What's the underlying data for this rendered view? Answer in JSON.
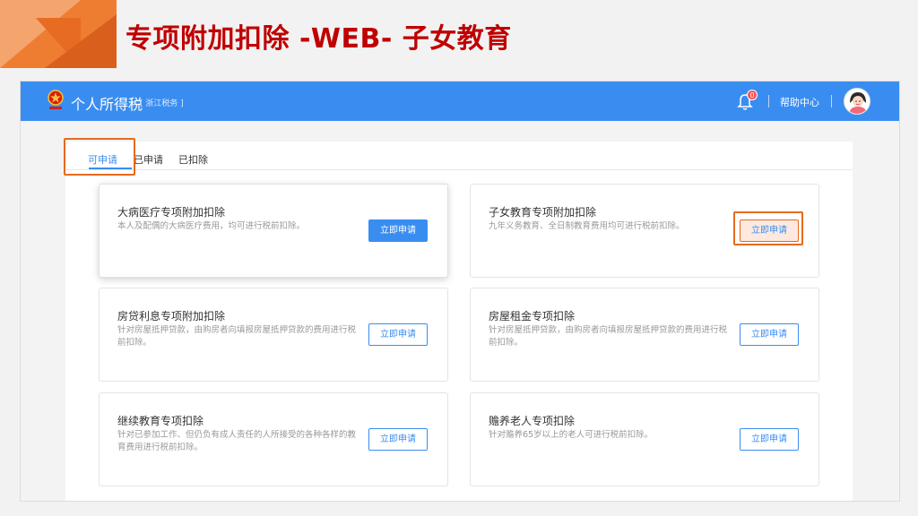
{
  "slide": {
    "title": "专项附加扣除 -WEB- 子女教育"
  },
  "header": {
    "app_name": "个人所得税",
    "region": "[ 浙江税务 ]",
    "notification_count": "0",
    "help_label": "帮助中心"
  },
  "tabs": [
    {
      "label": "可申请",
      "active": true
    },
    {
      "label": "已申请",
      "active": false
    },
    {
      "label": "已扣除",
      "active": false
    }
  ],
  "cards": [
    {
      "title": "大病医疗专项附加扣除",
      "desc": "本人及配偶的大病医疗费用，均可进行税前扣除。",
      "button": "立即申请"
    },
    {
      "title": "子女教育专项附加扣除",
      "desc": "九年义务教育、全日制教育费用均可进行税前扣除。",
      "button": "立即申请"
    },
    {
      "title": "房贷利息专项附加扣除",
      "desc": "针对房屋抵押贷款，由购房者向填报房屋抵押贷款的费用进行税前扣除。",
      "button": "立即申请"
    },
    {
      "title": "房屋租金专项扣除",
      "desc": "针对房屋抵押贷款，由购房者向填报房屋抵押贷款的费用进行税前扣除。",
      "button": "立即申请"
    },
    {
      "title": "继续教育专项扣除",
      "desc": "针对已参加工作、但仍负有成人责任的人所接受的各种各样的教育费用进行税前扣除。",
      "button": "立即申请"
    },
    {
      "title": "赡养老人专项扣除",
      "desc": "针对赡养65岁以上的老人可进行税前扣除。",
      "button": "立即申请"
    }
  ],
  "colors": {
    "header_blue": "#3a8df0",
    "title_red": "#c00000",
    "highlight_orange": "#e56a1d"
  }
}
